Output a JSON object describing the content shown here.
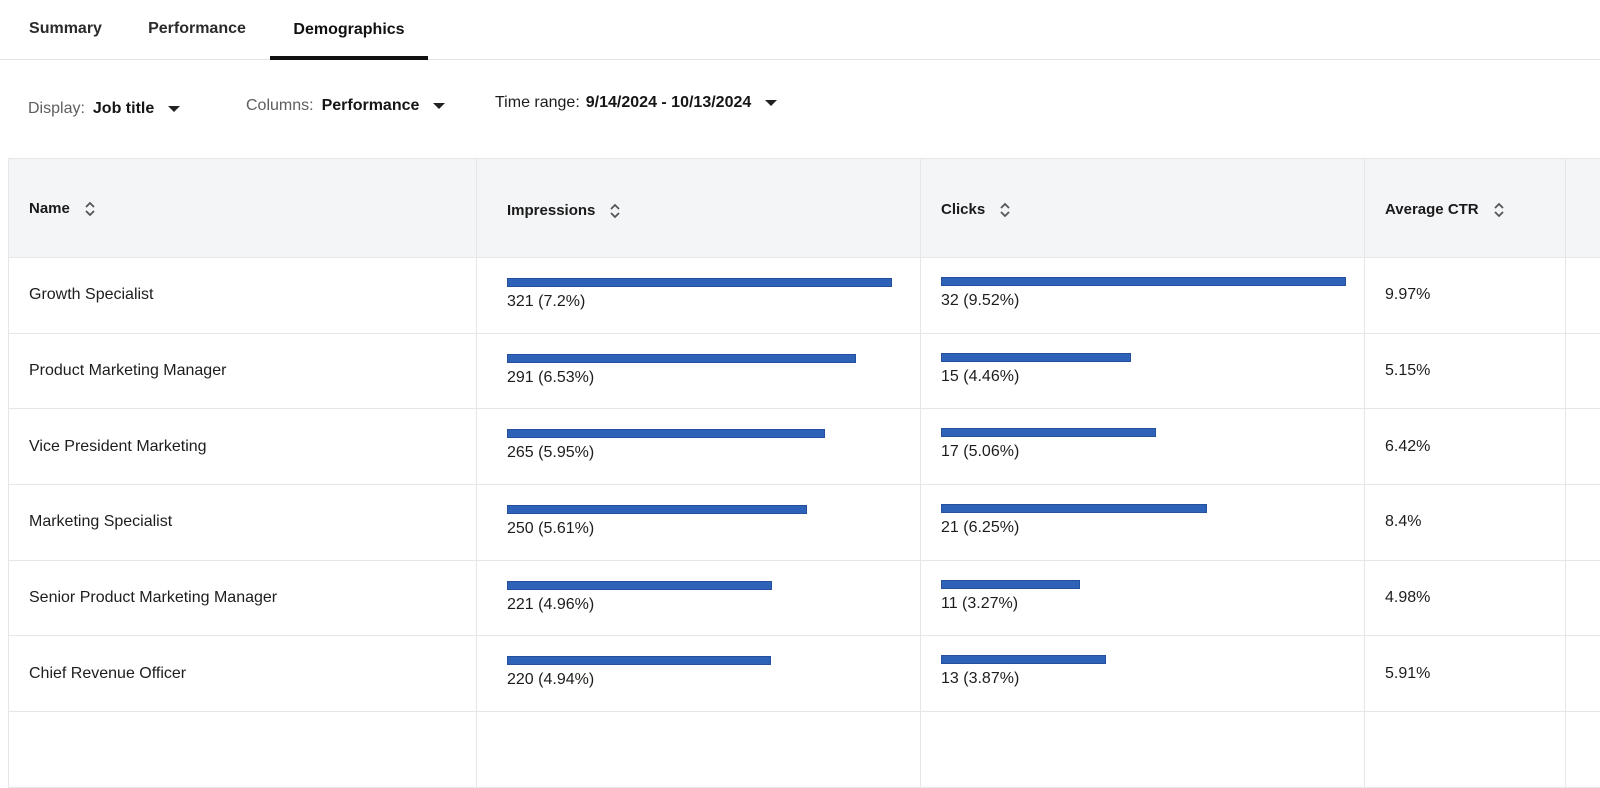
{
  "tabs": [
    {
      "label": "Summary",
      "active": false
    },
    {
      "label": "Performance",
      "active": false
    },
    {
      "label": "Demographics",
      "active": true
    }
  ],
  "filters": {
    "display": {
      "label": "Display:",
      "value": "Job title"
    },
    "columns": {
      "label": "Columns:",
      "value": "Performance"
    },
    "time_range": {
      "label": "Time range:",
      "value": "9/14/2024 - 10/13/2024"
    }
  },
  "table": {
    "columns": [
      "Name",
      "Impressions",
      "Clicks",
      "Average CTR"
    ],
    "bar_color": "#2e62b8",
    "rows": [
      {
        "name": "Growth Specialist",
        "impressions": 321,
        "impressions_label": "321 (7.2%)",
        "clicks": 32,
        "clicks_label": "32 (9.52%)",
        "ctr": "9.97%"
      },
      {
        "name": "Product Marketing Manager",
        "impressions": 291,
        "impressions_label": "291 (6.53%)",
        "clicks": 15,
        "clicks_label": "15 (4.46%)",
        "ctr": "5.15%"
      },
      {
        "name": "Vice President Marketing",
        "impressions": 265,
        "impressions_label": "265 (5.95%)",
        "clicks": 17,
        "clicks_label": "17 (5.06%)",
        "ctr": "6.42%"
      },
      {
        "name": "Marketing Specialist",
        "impressions": 250,
        "impressions_label": "250 (5.61%)",
        "clicks": 21,
        "clicks_label": "21 (6.25%)",
        "ctr": "8.4%"
      },
      {
        "name": "Senior Product Marketing Manager",
        "impressions": 221,
        "impressions_label": "221 (4.96%)",
        "clicks": 11,
        "clicks_label": "11 (3.27%)",
        "ctr": "4.98%"
      },
      {
        "name": "Chief Revenue Officer",
        "impressions": 220,
        "impressions_label": "220 (4.94%)",
        "clicks": 13,
        "clicks_label": "13 (3.87%)",
        "ctr": "5.91%"
      }
    ]
  }
}
